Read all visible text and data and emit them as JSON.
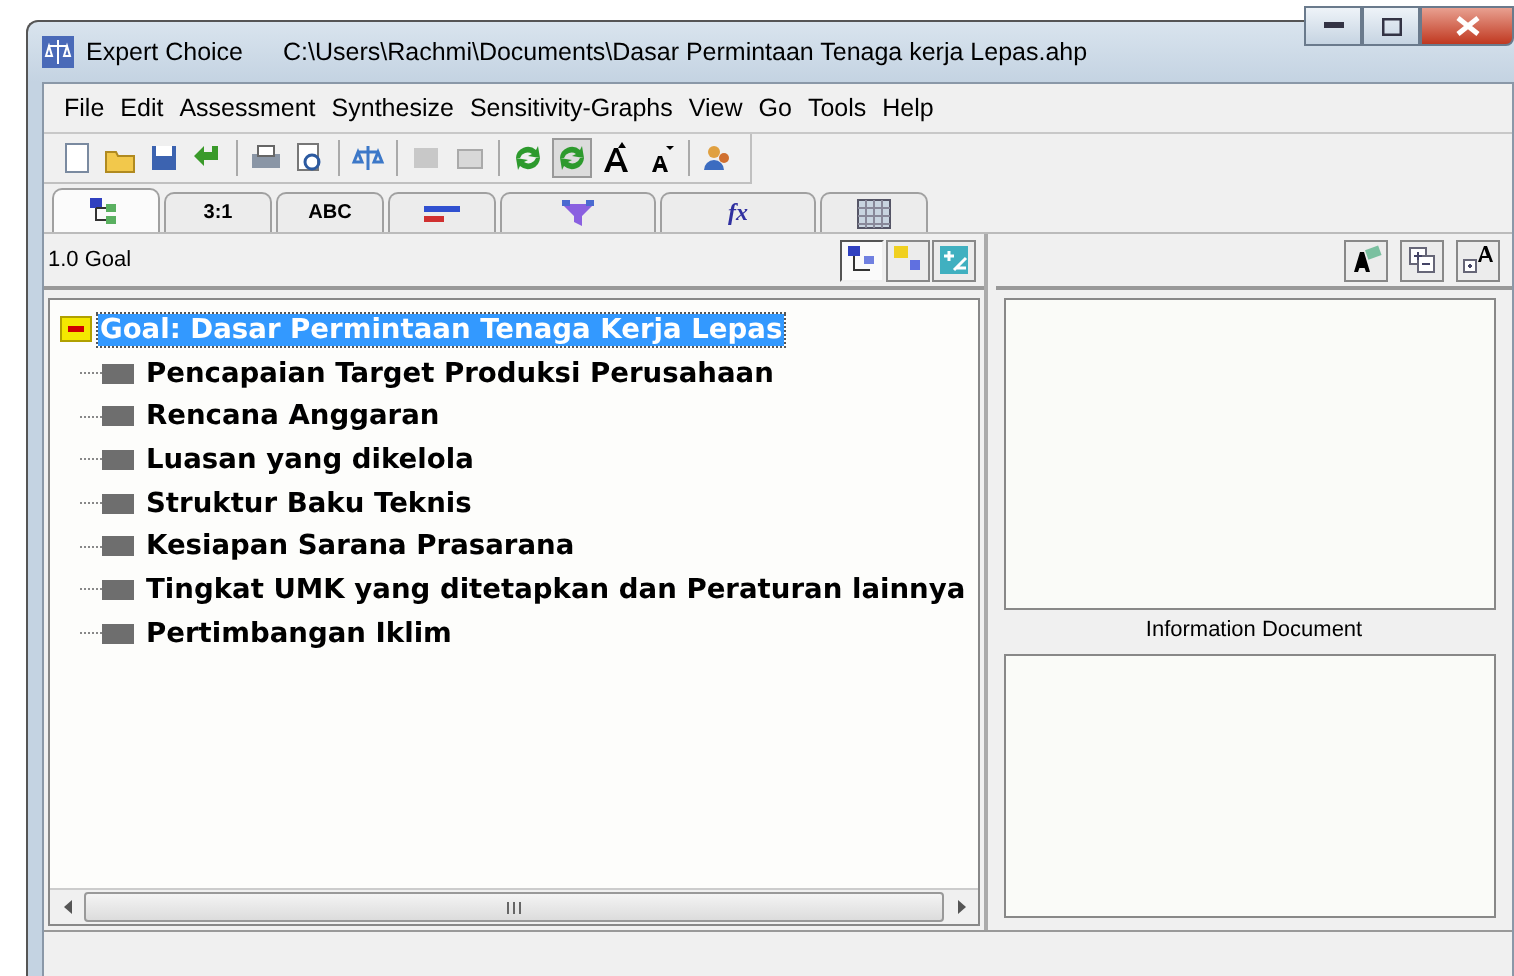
{
  "window": {
    "title": "Expert Choice",
    "file_path": "C:\\Users\\Rachmi\\Documents\\Dasar Permintaan Tenaga kerja Lepas.ahp"
  },
  "menu": [
    "File",
    "Edit",
    "Assessment",
    "Synthesize",
    "Sensitivity-Graphs",
    "View",
    "Go",
    "Tools",
    "Help"
  ],
  "toolbar": [
    {
      "kind": "new"
    },
    {
      "kind": "open"
    },
    {
      "kind": "save"
    },
    {
      "kind": "undo"
    },
    {
      "kind": "sep"
    },
    {
      "kind": "print"
    },
    {
      "kind": "preview"
    },
    {
      "kind": "sep"
    },
    {
      "kind": "scale"
    },
    {
      "kind": "sep"
    },
    {
      "kind": "disabled1"
    },
    {
      "kind": "disabled2"
    },
    {
      "kind": "sep"
    },
    {
      "kind": "refresh"
    },
    {
      "kind": "refresh2",
      "pressed": true
    },
    {
      "kind": "font-up"
    },
    {
      "kind": "font-down"
    },
    {
      "kind": "sep"
    },
    {
      "kind": "users"
    }
  ],
  "tabs": [
    {
      "kind": "tree",
      "selected": true
    },
    {
      "kind": "text",
      "label": "3:1",
      "selected": false
    },
    {
      "kind": "text",
      "label": "ABC",
      "selected": false
    },
    {
      "kind": "bars",
      "selected": false
    },
    {
      "kind": "funnel",
      "selected": false
    },
    {
      "kind": "formula",
      "label": "fx",
      "selected": false
    },
    {
      "kind": "grid",
      "selected": false
    }
  ],
  "tree_panel": {
    "header": "1.0 Goal",
    "tools": [
      {
        "kind": "tree",
        "pressed": true
      },
      {
        "kind": "nodes",
        "pressed": false
      },
      {
        "kind": "plusminus",
        "pressed": false
      }
    ]
  },
  "tree": {
    "label": "Goal: Dasar Permintaan Tenaga Kerja Lepas",
    "expanded": true,
    "selected": true,
    "children": [
      {
        "label": "Pencapaian Target Produksi Perusahaan",
        "selected": false
      },
      {
        "label": "Rencana Anggaran",
        "selected": false
      },
      {
        "label": "Luasan yang dikelola",
        "selected": false
      },
      {
        "label": "Struktur Baku Teknis",
        "selected": false
      },
      {
        "label": "Kesiapan Sarana Prasarana",
        "selected": false
      },
      {
        "label": "Tingkat UMK yang ditetapkan dan Peraturan lainnya",
        "selected": false
      },
      {
        "label": "Pertimbangan Iklim",
        "selected": false
      }
    ]
  },
  "right_panel": {
    "tools": [
      {
        "kind": "edit-text"
      },
      {
        "kind": "collapse"
      },
      {
        "kind": "font"
      }
    ],
    "info_label": "Information Document"
  }
}
